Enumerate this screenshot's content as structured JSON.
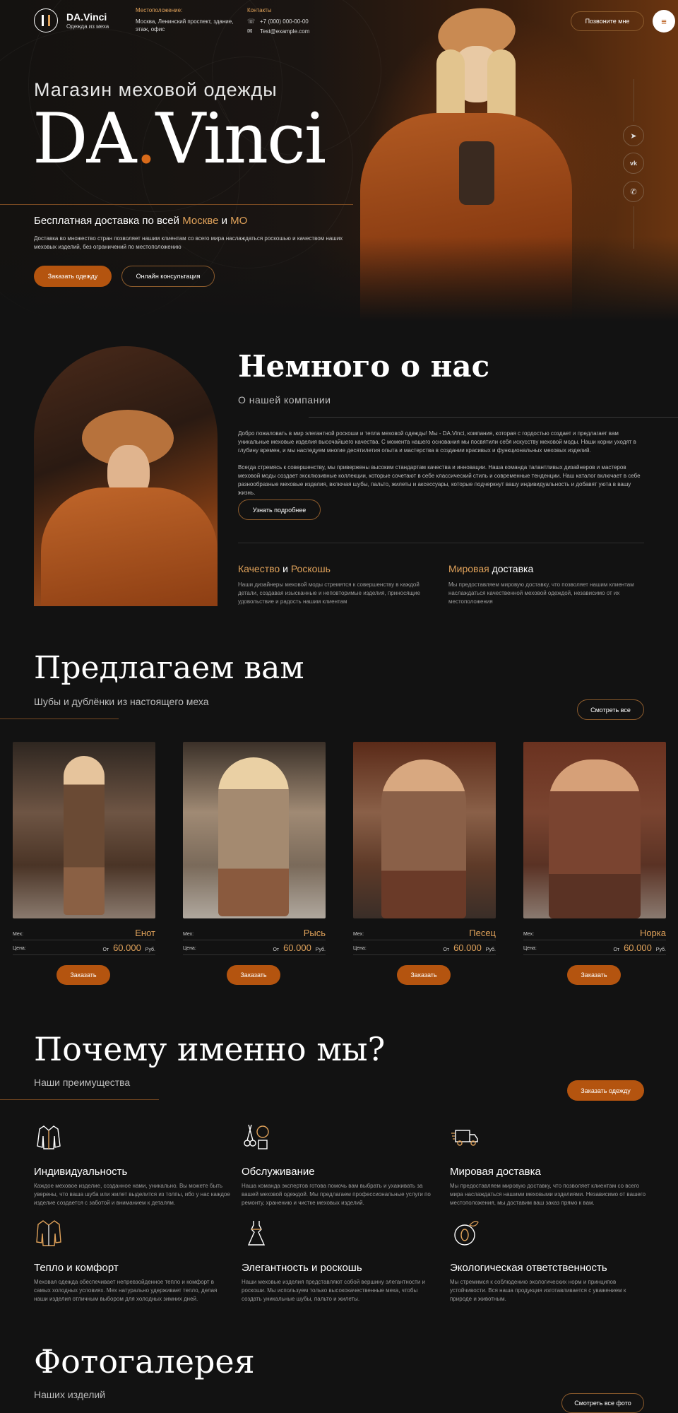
{
  "header": {
    "logo_name": "DA.Vinci",
    "logo_sub": "Одежда из меха",
    "location_label": "Местоположение:",
    "location_value": "Москва, Ленинский проспект, здание, этаж, офис",
    "contacts_label": "Контакты",
    "phone": "+7 (000) 000-00-00",
    "email": "Test@example.com",
    "call_button": "Позвоните мне"
  },
  "hero": {
    "subtitle": "Магазин меховой одежды",
    "title_part1": "DA",
    "title_dot": ".",
    "title_part2": "Vinci",
    "delivery_prefix": "Бесплатная доставка по всей ",
    "delivery_city": "Москве",
    "delivery_and": " и ",
    "delivery_region": "МО",
    "description": "Доставка во множество стран позволяет нашим клиентам со всего мира наслаждаться роскошью и качеством наших меховых изделий, без ограничений по местоположению",
    "order_button": "Заказать одежду",
    "consult_button": "Онлайн консультация",
    "socials": [
      "telegram-icon",
      "vk-icon",
      "whatsapp-icon"
    ]
  },
  "about": {
    "title": "Немного о нас",
    "subtitle": "О нашей компании",
    "para1": "Добро пожаловать в мир элегантной роскоши и тепла меховой одежды! Мы - DA.Vinci, компания, которая с гордостью создает и предлагает вам уникальные меховые изделия высочайшего качества. С момента нашего основания мы посвятили себя искусству меховой моды. Наши корни уходят в глубину времен, и мы наследуем многие десятилетия опыта и мастерства в создании красивых и функциональных меховых изделий.",
    "para2": "Всегда стремясь к совершенству, мы привержены высоким стандартам качества и инновации. Наша команда талантливых дизайнеров и мастеров меховой моды создает эксклюзивные коллекции, которые сочетают в себе классический стиль и современные тенденции. Наш каталог включает в себе разнообразные меховые изделия, включая шубы, пальто, жилеты и аксессуары, которые подчеркнут вашу индивидуальность и добавят уюта в вашу жизнь.",
    "more_button": "Узнать подробнее",
    "feature1_title_a": "Качество",
    "feature1_title_b": " и ",
    "feature1_title_c": "Роскошь",
    "feature1_text": "Наши дизайнеры меховой моды стремятся к совершенству в каждой детали, создавая изысканные и неповторимые изделия, приносящие удовольствие и радость нашим клиентам",
    "feature2_title_a": "Мировая",
    "feature2_title_b": " доставка",
    "feature2_text": "Мы предоставляем мировую доставку, что позволяет нашим клиентам наслаждаться качественной меховой одеждой, независимо от их местоположения"
  },
  "offer": {
    "title": "Предлагаем вам",
    "subtitle": "Шубы и дублёнки из настоящего меха",
    "view_all_button": "Смотреть все",
    "fur_label": "Мех:",
    "price_label": "Цена:",
    "price_from": "От",
    "currency": "Руб.",
    "order_button": "Заказать",
    "products": [
      {
        "fur": "Енот",
        "price": "60.000"
      },
      {
        "fur": "Рысь",
        "price": "60.000"
      },
      {
        "fur": "Песец",
        "price": "60.000"
      },
      {
        "fur": "Норка",
        "price": "60.000"
      }
    ]
  },
  "why": {
    "title": "Почему именно мы?",
    "subtitle": "Наши преимущества",
    "order_button": "Заказать одежду",
    "items": [
      {
        "icon": "fur-jacket-icon",
        "title": "Индивидуальность",
        "text": "Каждое меховое изделие, созданное нами, уникально. Вы можете быть уверены, что ваша шуба или жилет выделится из толпы, ибо у нас каждое изделие создается с заботой и вниманием к деталям."
      },
      {
        "icon": "tailor-tools-icon",
        "title": "Обслуживание",
        "text": "Наша команда экспертов готова помочь вам выбрать и ухаживать за вашей меховой одеждой. Мы предлагаем профессиональные услуги по ремонту, хранению и чистке меховых изделий."
      },
      {
        "icon": "delivery-truck-icon",
        "title": "Мировая доставка",
        "text": "Мы предоставляем мировую доставку, что позволяет клиентам со всего мира наслаждаться нашими меховыми изделиями. Независимо от вашего местоположения, мы доставим ваш заказ прямо к вам."
      },
      {
        "icon": "coat-icon",
        "title": "Тепло и комфорт",
        "text": "Меховая одежда обеспечивает непревзойденное тепло и комфорт в самых холодных условиях. Мех натурально удерживает тепло, делая наши изделия отличным выбором для холодных зимних дней."
      },
      {
        "icon": "dress-icon",
        "title": "Элегантность и роскошь",
        "text": "Наши меховые изделия представляют собой вершину элегантности и роскоши. Мы используем только высококачественные меха, чтобы создать уникальные шубы, пальто и жилеты."
      },
      {
        "icon": "eco-icon",
        "title": "Экологическая ответственность",
        "text": "Мы стремимся к соблюдению экологических норм и принципов устойчивости. Вся наша продукция изготавливается с уважением к природе и животным."
      }
    ]
  },
  "gallery": {
    "title": "Фотогалерея",
    "subtitle": "Наших изделий",
    "view_all_button": "Смотреть все фото"
  },
  "colors": {
    "accent": "#e0a25a",
    "button": "#b4540f",
    "background": "#121212"
  }
}
